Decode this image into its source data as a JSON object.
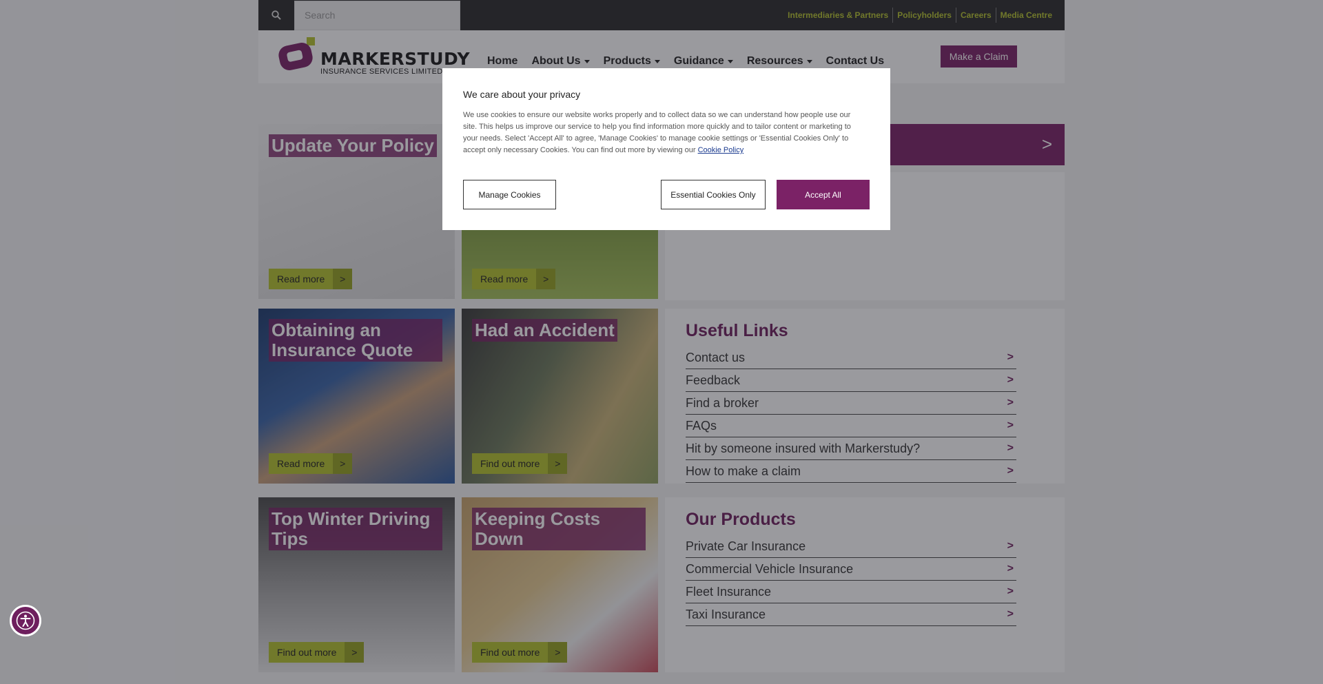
{
  "topbar": {
    "search_placeholder": "Search",
    "links": [
      "Intermediaries & Partners",
      "Policyholders",
      "Careers",
      "Media Centre"
    ]
  },
  "header": {
    "logo_line1": "MARKERSTUDY",
    "logo_line2": "INSURANCE SERVICES LIMITED",
    "nav": [
      "Home",
      "About Us",
      "Products",
      "Guidance",
      "Resources",
      "Contact Us"
    ],
    "claim_label": "Make a Claim"
  },
  "tiles": {
    "update_policy": {
      "title": "Update Your Policy",
      "button": "Read more"
    },
    "bike": {
      "button": "Read more"
    },
    "quote": {
      "title": "Obtaining an Insurance Quote",
      "button": "Read more"
    },
    "accident": {
      "title": "Had an Accident",
      "button": "Find out more"
    },
    "winter": {
      "title": "Top Winter Driving Tips",
      "button": "Find out more"
    },
    "costs": {
      "title": "Keeping Costs Down",
      "button": "Find out more"
    },
    "arrow": ">"
  },
  "banner": {
    "arrow": ">"
  },
  "useful_links": {
    "title": "Useful Links",
    "items": [
      "Contact us",
      "Feedback",
      "Find a broker",
      "FAQs",
      "Hit by someone insured with Markerstudy?",
      "How to make a claim"
    ]
  },
  "products": {
    "title": "Our Products",
    "items": [
      "Private Car Insurance",
      "Commercial Vehicle Insurance",
      "Fleet Insurance",
      "Taxi Insurance"
    ]
  },
  "cookie_modal": {
    "title": "We care about your privacy",
    "body": "We use cookies to ensure our website works properly and to collect data so we can understand how people use our site. This helps us improve our service to help you find information more quickly and to tailor content or marketing to your needs. Select 'Accept All' to agree, 'Manage Cookies' to manage cookie settings or 'Essential Cookies Only' to accept only necessary Cookies. You can find out more by viewing our",
    "policy_link": "Cookie Policy",
    "manage_label": "Manage Cookies",
    "essential_label": "Essential Cookies Only",
    "accept_label": "Accept All"
  },
  "colors": {
    "brand": "#7b2266",
    "accent": "#b5c42e",
    "topbar": "#2b2b2b"
  },
  "icons": {
    "search": "search-icon",
    "accessibility": "accessibility-icon"
  }
}
